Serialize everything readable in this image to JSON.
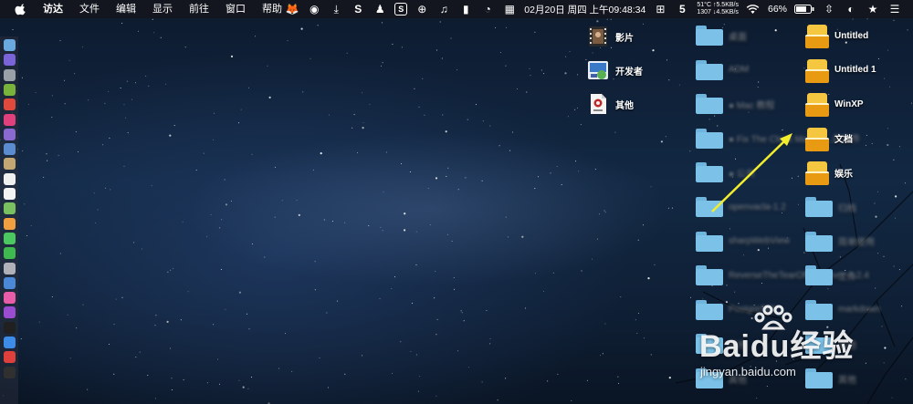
{
  "menubar": {
    "apple_icon": "apple-icon",
    "items": [
      "访达",
      "文件",
      "编辑",
      "显示",
      "前往",
      "窗口",
      "帮助"
    ],
    "status": {
      "icons": [
        "fox-icon",
        "shield-icon",
        "download-icon",
        "s-app-icon",
        "qq-icon",
        "s-box-icon",
        "globe-icon",
        "music-note-icon",
        "message-icon",
        "gauge-icon",
        "calendar-icon"
      ],
      "datetime": "02月20日 周四 上午09:48:34",
      "icons2": [
        "grid-icon",
        "5-icon"
      ],
      "net_line1": "51°C ↑5.5KB/s",
      "net_line2": "1307 ↓4.5KB/s",
      "wifi_icon": "wifi-icon",
      "battery": "66%",
      "battery_icon": "battery-icon",
      "icons3": [
        "split-icon",
        "user-icon",
        "star-icon",
        "list-icon"
      ]
    }
  },
  "dock": {
    "icons": [
      {
        "name": "finder-icon",
        "color": "#6aa8e0"
      },
      {
        "name": "siri-icon",
        "color": "#7a64d8"
      },
      {
        "name": "launchpad-icon",
        "color": "#9aa0a8"
      },
      {
        "name": "android-icon",
        "color": "#78b43c"
      },
      {
        "name": "chrome-icon",
        "color": "#e04a3c"
      },
      {
        "name": "music-app-icon",
        "color": "#e0407c"
      },
      {
        "name": "app-purple-icon",
        "color": "#8a6ad0"
      },
      {
        "name": "preview-icon",
        "color": "#5c8cd0"
      },
      {
        "name": "notes-icon",
        "color": "#c4a874"
      },
      {
        "name": "calendar-app-icon",
        "color": "#f0f0f0"
      },
      {
        "name": "textedit-icon",
        "color": "#f4f4f4"
      },
      {
        "name": "maps-icon",
        "color": "#78c060"
      },
      {
        "name": "photos-icon",
        "color": "#f0a040"
      },
      {
        "name": "messages-icon",
        "color": "#4cc860"
      },
      {
        "name": "facetime-icon",
        "color": "#40b850"
      },
      {
        "name": "clock-icon",
        "color": "#b0b0b8"
      },
      {
        "name": "keynote-icon",
        "color": "#4c88d8"
      },
      {
        "name": "itunes-icon",
        "color": "#e85ca8"
      },
      {
        "name": "podcasts-icon",
        "color": "#9a4cd0"
      },
      {
        "name": "appletv-icon",
        "color": "#202020"
      },
      {
        "name": "appstore-icon",
        "color": "#3c8ce8"
      },
      {
        "name": "vivaldi-icon",
        "color": "#e0403c"
      },
      {
        "name": "terminal-icon",
        "color": "#303030"
      }
    ]
  },
  "desktop": {
    "apps": [
      {
        "label": "影片",
        "icon": "film-app-icon"
      },
      {
        "label": "开发者",
        "icon": "developer-app-icon"
      },
      {
        "label": "其他",
        "icon": "document-app-icon"
      }
    ],
    "middle_folders": [
      {
        "label": "桌面"
      },
      {
        "label": "ADM"
      },
      {
        "label": "● Mac 教程"
      },
      {
        "label": "● Fix The Clock MacOS...的复件"
      },
      {
        "label": "● 公共"
      },
      {
        "label": "openvacla-1.2"
      },
      {
        "label": "sharpWebView"
      },
      {
        "label": "ReverseTheTearOff gitserver-1.2.4"
      },
      {
        "label": "PostgreSQL"
      },
      {
        "label": "其他"
      },
      {
        "label": "其他"
      }
    ],
    "right_folders": [
      {
        "label": "Untitled",
        "style": "yellow"
      },
      {
        "label": "Untitled 1",
        "style": "yellow"
      },
      {
        "label": "WinXP",
        "style": "yellow"
      },
      {
        "label": "文档",
        "style": "yellow"
      },
      {
        "label": "娱乐",
        "style": "yellow"
      },
      {
        "label": "归档",
        "style": "blue"
      },
      {
        "label": "简单使用",
        "style": "blue"
      },
      {
        "label": "工作",
        "style": "blue"
      },
      {
        "label": "markdown",
        "style": "blue"
      },
      {
        "label": "其他",
        "style": "blue"
      },
      {
        "label": "其他",
        "style": "blue"
      }
    ]
  },
  "annotation": {
    "arrow_color": "#f2ee2e"
  },
  "watermark": {
    "main": "Baidu经验",
    "url": "jingyan.baidu.com"
  }
}
